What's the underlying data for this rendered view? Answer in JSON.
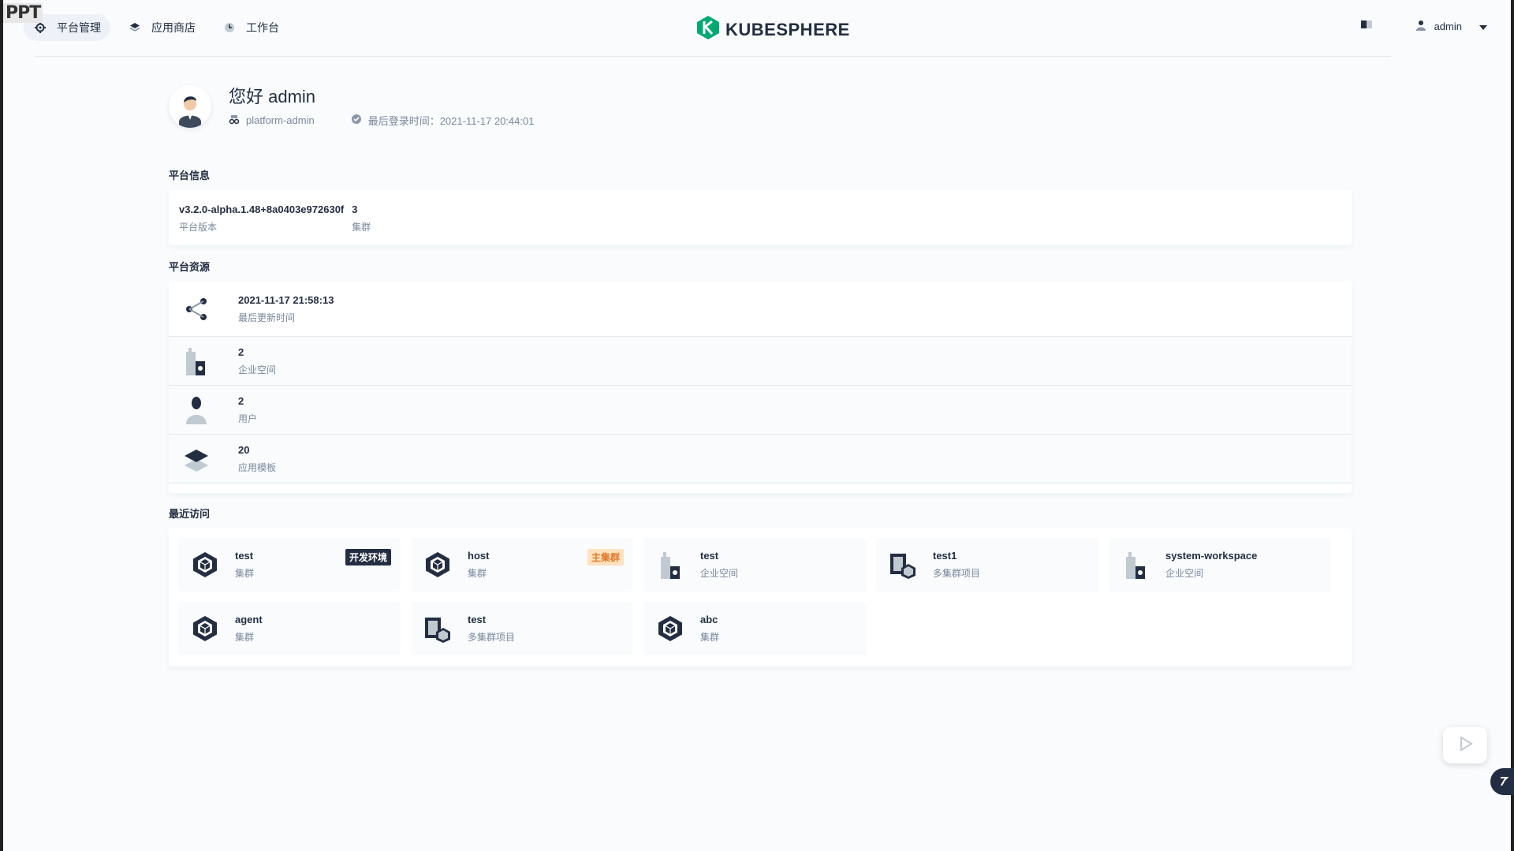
{
  "watermark": "PPT",
  "header": {
    "nav": [
      {
        "label": "平台管理",
        "icon": "gear-icon",
        "active": true
      },
      {
        "label": "应用商店",
        "icon": "layers-icon",
        "active": false
      },
      {
        "label": "工作台",
        "icon": "clock-icon",
        "active": false
      }
    ],
    "logo_text": "KUBESPHERE",
    "user": "admin"
  },
  "profile": {
    "greeting": "您好 admin",
    "role": "platform-admin",
    "last_login": "最后登录时间：2021-11-17 20:44:01"
  },
  "platform_info": {
    "title": "平台信息",
    "version_value": "v3.2.0-alpha.1.48+8a0403e972630f",
    "version_label": "平台版本",
    "clusters_value": "3",
    "clusters_label": "集群"
  },
  "platform_resources": {
    "title": "平台资源",
    "rows": [
      {
        "value": "2021-11-17 21:58:13",
        "label": "最后更新时间",
        "icon": "share-icon"
      },
      {
        "value": "2",
        "label": "企业空间",
        "icon": "workspace-icon"
      },
      {
        "value": "2",
        "label": "用户",
        "icon": "user-icon"
      },
      {
        "value": "20",
        "label": "应用模板",
        "icon": "template-icon"
      }
    ]
  },
  "recent": {
    "title": "最近访问",
    "items": [
      {
        "name": "test",
        "type": "集群",
        "icon": "cluster-icon",
        "tag": "开发环境",
        "tag_style": "dark"
      },
      {
        "name": "host",
        "type": "集群",
        "icon": "cluster-icon",
        "tag": "主集群",
        "tag_style": "orange"
      },
      {
        "name": "test",
        "type": "企业空间",
        "icon": "workspace-icon",
        "tag": "",
        "tag_style": ""
      },
      {
        "name": "test1",
        "type": "多集群项目",
        "icon": "multicluster-project-icon",
        "tag": "",
        "tag_style": ""
      },
      {
        "name": "system-workspace",
        "type": "企业空间",
        "icon": "workspace-icon",
        "tag": "",
        "tag_style": ""
      },
      {
        "name": "agent",
        "type": "集群",
        "icon": "cluster-icon",
        "tag": "",
        "tag_style": ""
      },
      {
        "name": "test",
        "type": "多集群项目",
        "icon": "multicluster-project-icon",
        "tag": "",
        "tag_style": ""
      },
      {
        "name": "abc",
        "type": "集群",
        "icon": "cluster-icon",
        "tag": "",
        "tag_style": ""
      }
    ]
  },
  "colors": {
    "brand": "#00a971",
    "text": "#242e42",
    "muted": "#79879c"
  }
}
